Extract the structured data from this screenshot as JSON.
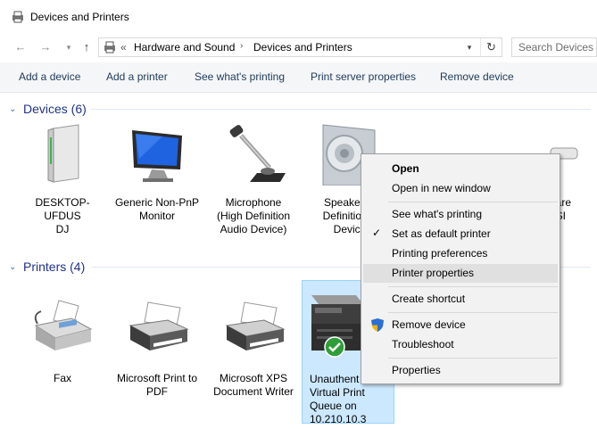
{
  "window": {
    "title": "Devices and Printers"
  },
  "address": {
    "overflow": "«",
    "crumbs": [
      "Hardware and Sound",
      "Devices and Printers"
    ],
    "search_placeholder": "Search Devices a"
  },
  "commands": [
    "Add a device",
    "Add a printer",
    "See what's printing",
    "Print server properties",
    "Remove device"
  ],
  "groups": {
    "devices": {
      "title": "Devices (6)",
      "items": [
        {
          "label": "DESKTOP-UFDUS\nDJ",
          "icon": "desktop-tower-icon"
        },
        {
          "label": "Generic Non-PnP\nMonitor",
          "icon": "monitor-icon"
        },
        {
          "label": "Microphone\n(High Definition\nAudio Device)",
          "icon": "microphone-icon"
        },
        {
          "label": "Speakers (\nDefinition A\nDevice",
          "icon": "speaker-icon"
        },
        {
          "label": "ware\nCSI\nce",
          "icon": "usb-drive-icon"
        }
      ]
    },
    "printers": {
      "title": "Printers (4)",
      "items": [
        {
          "label": "Fax",
          "icon": "fax-icon"
        },
        {
          "label": "Microsoft Print to\nPDF",
          "icon": "printer-icon"
        },
        {
          "label": "Microsoft XPS\nDocument Writer",
          "icon": "printer-icon"
        },
        {
          "label": "Unauthent\nVirtual Print\nQueue on\n10.210.10.3",
          "icon": "mfp-printer-icon",
          "status": "default-check-icon"
        }
      ]
    }
  },
  "context_menu": {
    "items": [
      {
        "label": "Open",
        "bold": true
      },
      {
        "label": "Open in new window"
      },
      {
        "label": "See what's printing"
      },
      {
        "label": "Set as default printer",
        "checked": true
      },
      {
        "label": "Printing preferences"
      },
      {
        "label": "Printer properties",
        "highlighted": true
      },
      {
        "label": "Create shortcut"
      },
      {
        "label": "Remove device",
        "icon": "uac-shield-icon"
      },
      {
        "label": "Troubleshoot"
      },
      {
        "label": "Properties"
      }
    ]
  },
  "colors": {
    "group_title": "#1e3287",
    "command_text": "#1e395b",
    "selection": "#cce8ff",
    "check_green": "#2e9e3a"
  }
}
